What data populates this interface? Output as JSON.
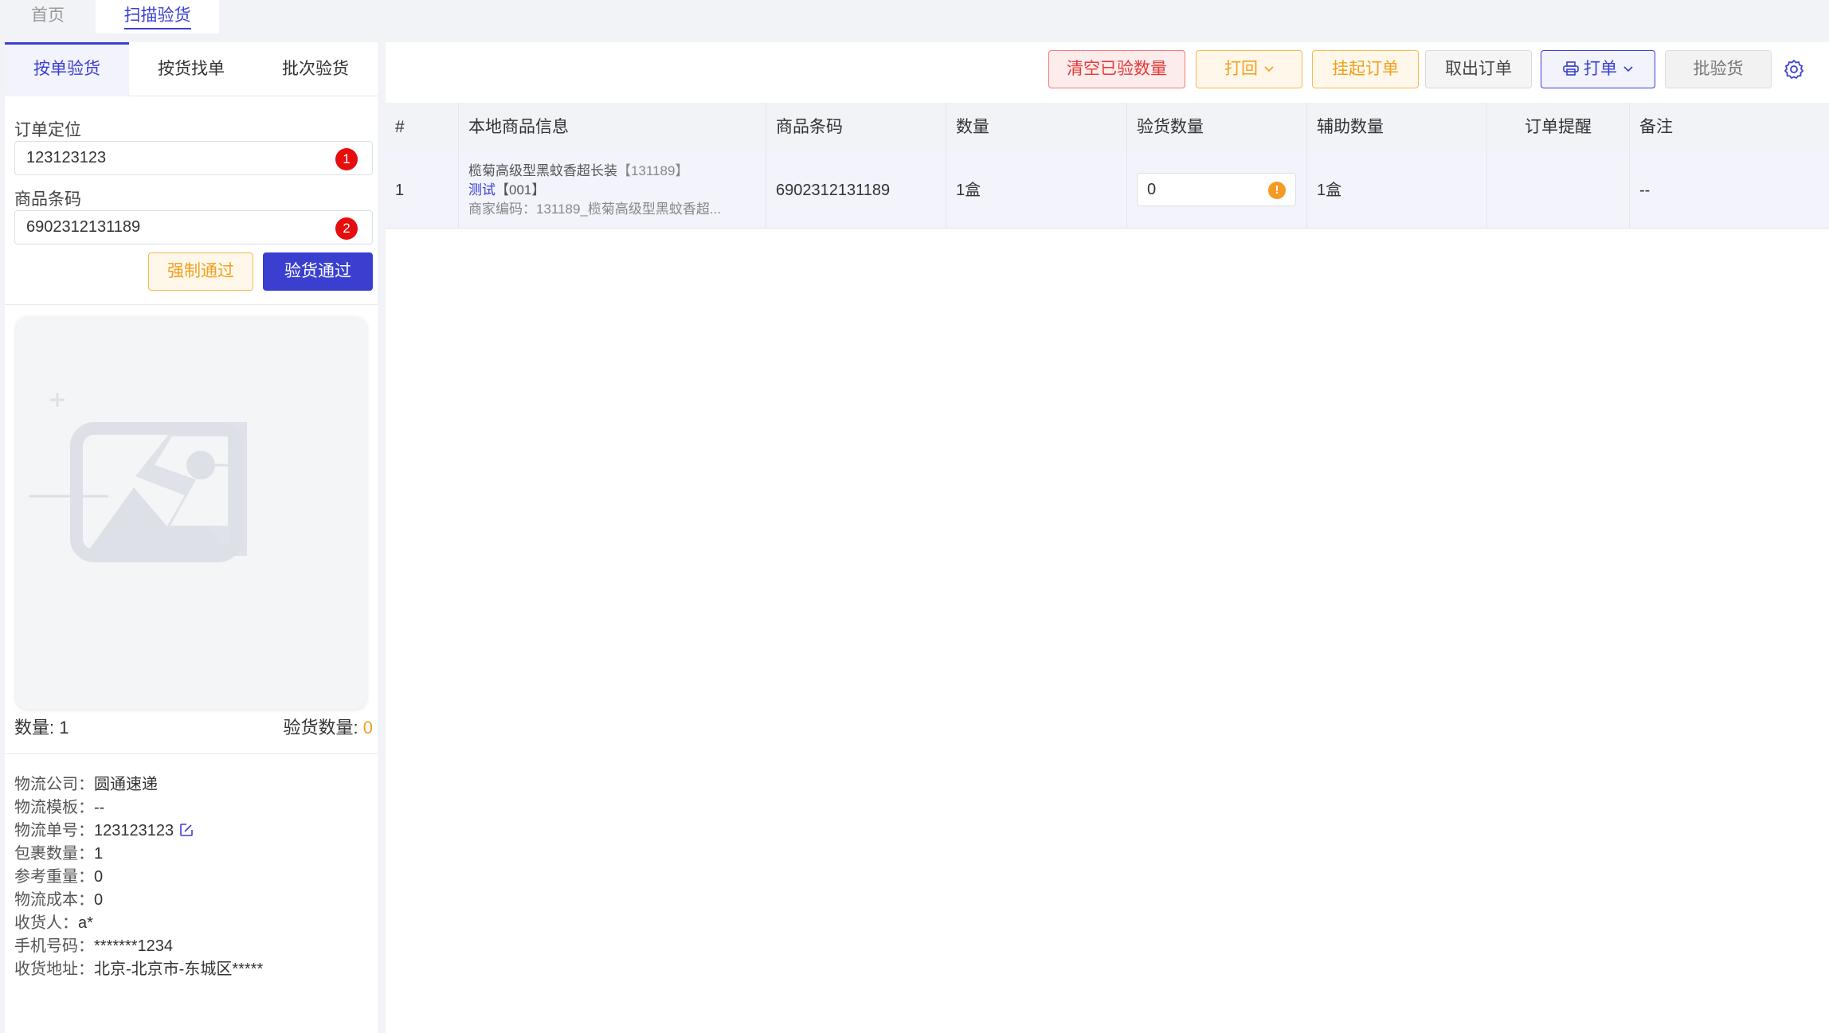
{
  "top_tabs": {
    "home": "首页",
    "scan": "扫描验货"
  },
  "left_tabs": [
    "按单验货",
    "按货找单",
    "批次验货"
  ],
  "form": {
    "order_label": "订单定位",
    "order_value": "123123123",
    "order_badge": "1",
    "barcode_label": "商品条码",
    "barcode_value": "6902312131189",
    "barcode_badge": "2",
    "force_pass": "强制通过",
    "check_pass": "验货通过"
  },
  "summary": {
    "qty_label": "数量: 1",
    "checked_label": "验货数量: ",
    "checked_value": "0"
  },
  "logistics": [
    {
      "label": "物流公司：",
      "value": "圆通速递"
    },
    {
      "label": "物流模板：",
      "value": "--"
    },
    {
      "label": "物流单号：",
      "value": "123123123",
      "icon": "edit-icon"
    },
    {
      "label": "包裹数量：",
      "value": "1"
    },
    {
      "label": "参考重量：",
      "value": "0"
    },
    {
      "label": "物流成本：",
      "value": "0"
    },
    {
      "label": "收货人：",
      "value": "a*"
    },
    {
      "label": "手机号码：",
      "value": "*******1234"
    },
    {
      "label": "收货地址：",
      "value": "北京-北京市-东城区*****"
    }
  ],
  "toolbar": {
    "clear": "清空已验数量",
    "back": "打回",
    "hang": "挂起订单",
    "take": "取出订单",
    "print": "打单",
    "batch": "批验货"
  },
  "table": {
    "headers": [
      "#",
      "本地商品信息",
      "商品条码",
      "数量",
      "验货数量",
      "辅助数量",
      "订单提醒",
      "备注"
    ],
    "rows": [
      {
        "index": "1",
        "name": "榄菊高级型黑蚊香超长装",
        "name_code": "【131189】",
        "spec": "测试",
        "spec_code": "【001】",
        "merchant": "商家编码：131189_榄菊高级型黑蚊香超...",
        "barcode": "6902312131189",
        "qty": "1盒",
        "checked": "0",
        "aux_qty": "1盒",
        "reminder": "",
        "remark": "--"
      }
    ]
  },
  "colors": {
    "primary": "#3a3fd0",
    "warning": "#f0a020",
    "danger": "#e53939",
    "badge": "#e50d0d"
  }
}
